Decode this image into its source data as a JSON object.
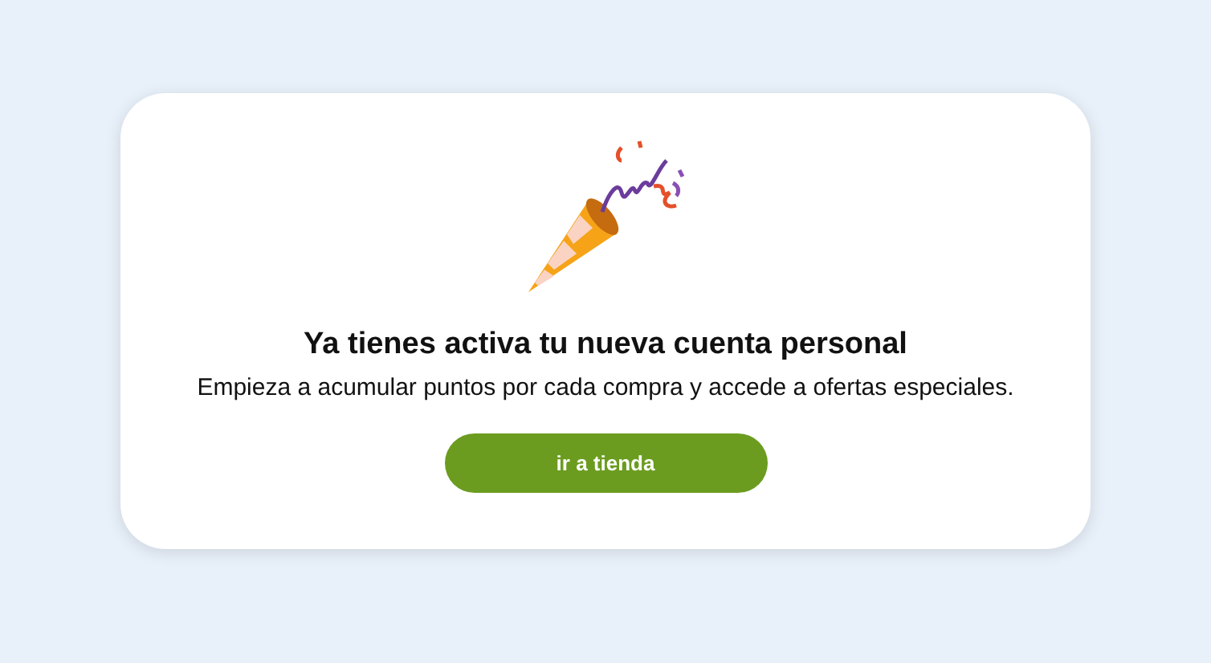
{
  "card": {
    "title": "Ya tienes activa tu nueva cuenta personal",
    "message": "Empieza a acumular puntos por cada compra y accede a ofertas especiales.",
    "button": "ir a tienda"
  }
}
